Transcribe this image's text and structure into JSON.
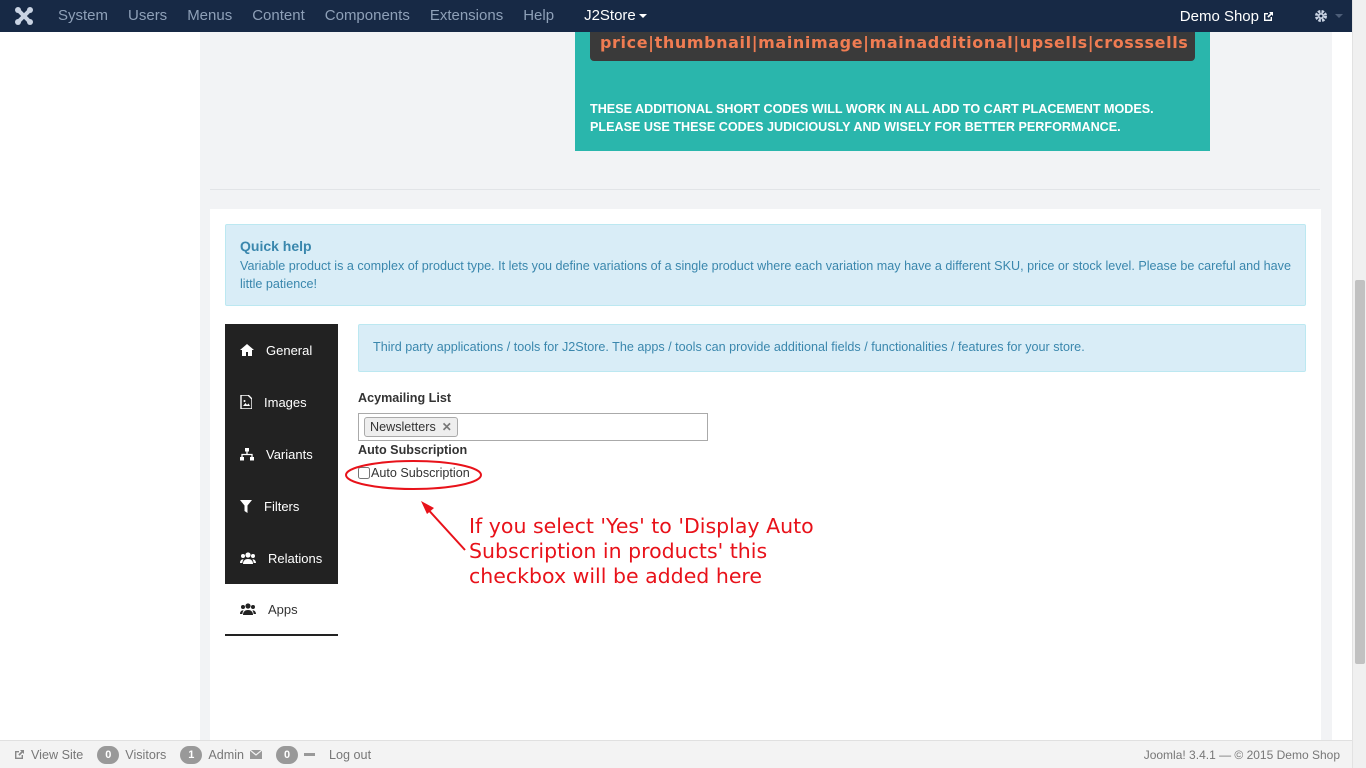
{
  "navbar": {
    "menu": [
      "System",
      "Users",
      "Menus",
      "Content",
      "Components",
      "Extensions",
      "Help"
    ],
    "active_menu": "J2Store",
    "site_link": "Demo Shop"
  },
  "teal_notice": {
    "code_line": "price|thumbnail|mainimage|mainadditional|upsells|crosssells",
    "line1": "THESE ADDITIONAL SHORT CODES WILL WORK IN ALL ADD TO CART PLACEMENT MODES.",
    "line2": "PLEASE USE THESE CODES JUDICIOUSLY AND WISELY FOR BETTER PERFORMANCE."
  },
  "quick_help": {
    "title": "Quick help",
    "text": "Variable product is a complex of product type. It lets you define variations of a single product where each variation may have a different SKU, price or stock level. Please be careful and have little patience!"
  },
  "tabs": [
    {
      "label": "General",
      "icon": "home-icon"
    },
    {
      "label": "Images",
      "icon": "image-icon"
    },
    {
      "label": "Variants",
      "icon": "sitemap-icon"
    },
    {
      "label": "Filters",
      "icon": "filter-icon"
    },
    {
      "label": "Relations",
      "icon": "users-icon"
    },
    {
      "label": "Apps",
      "icon": "users-icon"
    }
  ],
  "active_tab": "Apps",
  "apps": {
    "info": "Third party applications / tools for J2Store. The apps / tools can provide additional fields / functionalities / features for your store.",
    "acymailing_label": "Acymailing List",
    "selected_list": "Newsletters",
    "auto_sub_heading": "Auto Subscription",
    "auto_sub_checkbox": "Auto Subscription",
    "auto_sub_checked": false
  },
  "annotation": {
    "text": "If you select 'Yes' to 'Display Auto Subscription in products' this checkbox will be added here",
    "color": "#e8121a"
  },
  "footer": {
    "view_site": "View Site",
    "visitors_count": "0",
    "visitors_label": "Visitors",
    "admin_count": "1",
    "admin_label": "Admin",
    "messages_count": "0",
    "logout": "Log out",
    "copyright": "Joomla! 3.4.1  —  © 2015 Demo Shop"
  }
}
